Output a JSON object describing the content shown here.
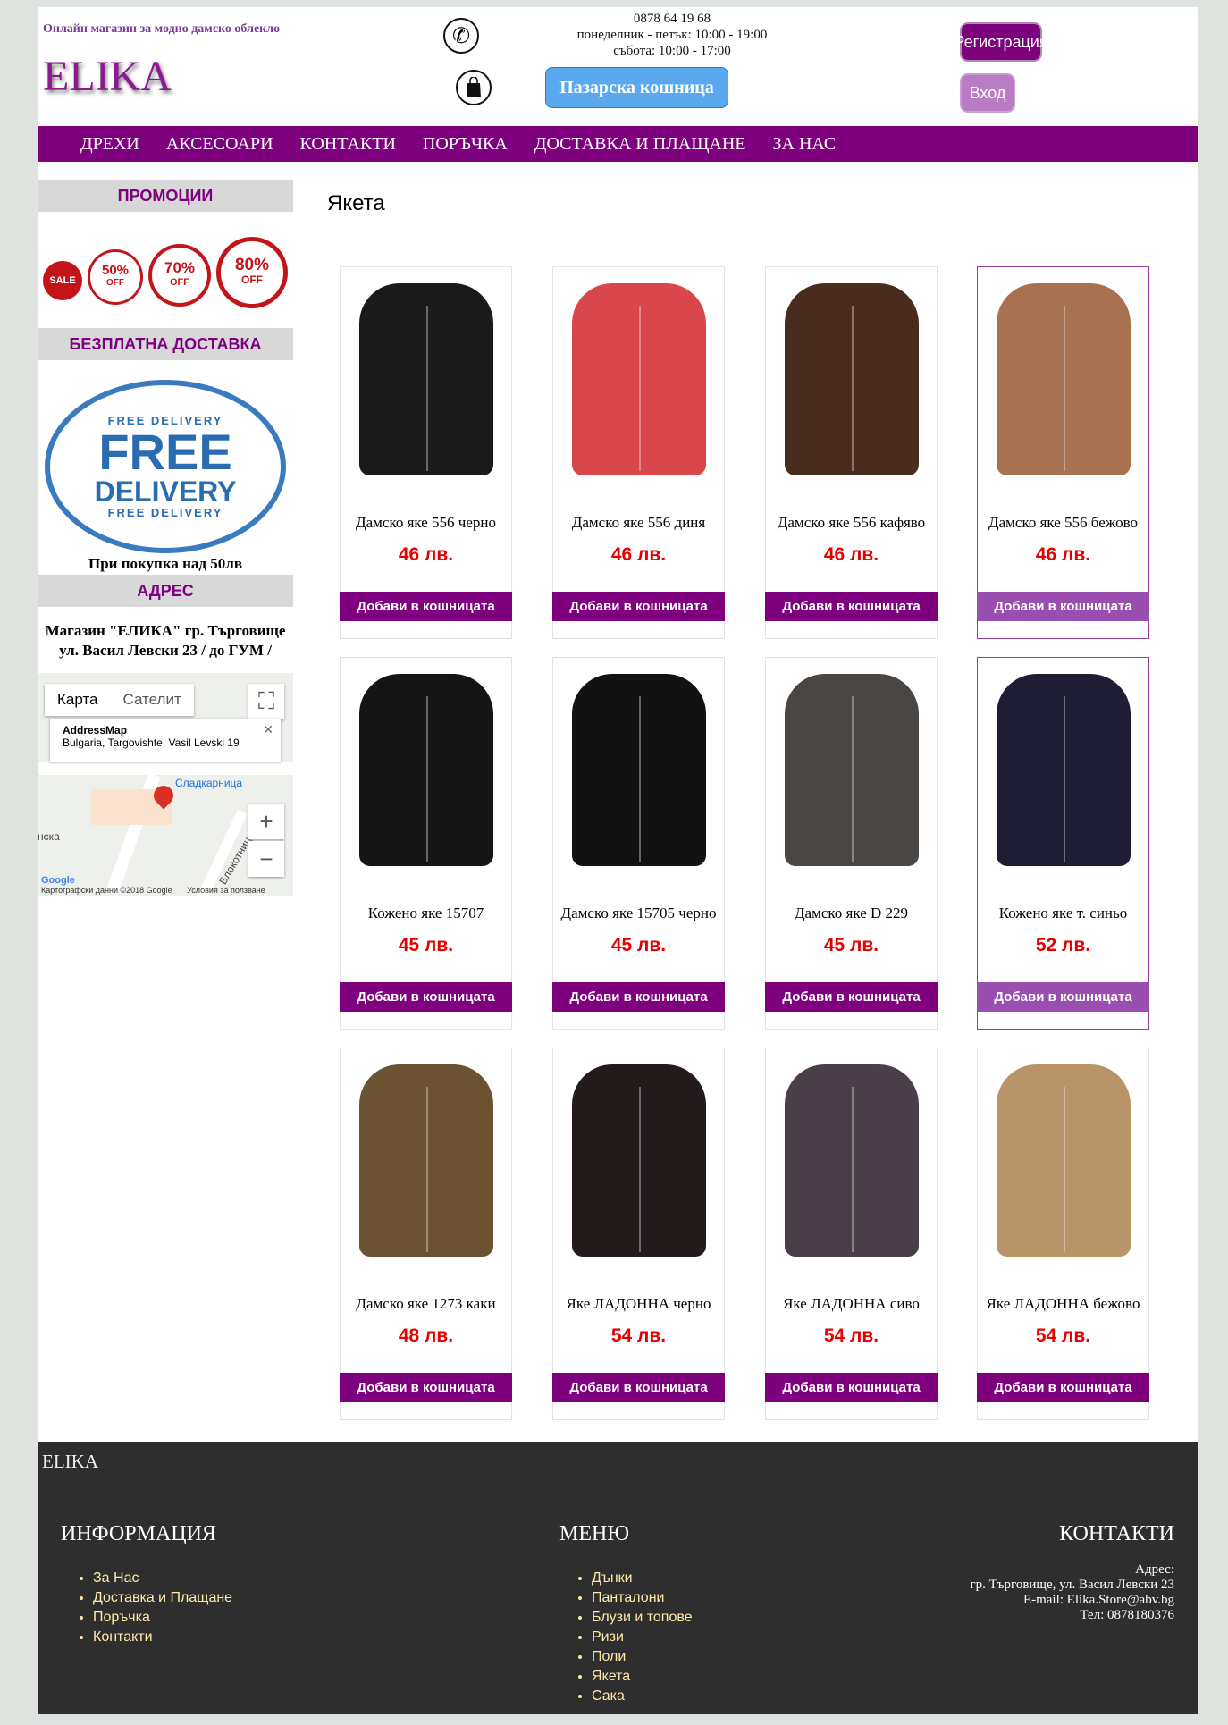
{
  "header": {
    "tagline": "Онлайн магазин за модно дамско облекло",
    "logo": "ELIKA",
    "phone": "0878 64 19 68",
    "hours_weekdays": "понеделник - петък: 10:00 - 19:00",
    "hours_saturday": "събота: 10:00 - 17:00",
    "cart_label": "Пазарска кошница",
    "register_label": "Регистрация",
    "login_label": "Вход"
  },
  "nav": [
    "ДРЕХИ",
    "АКСЕСОАРИ",
    "КОНТАКТИ",
    "ПОРЪЧКА",
    "ДОСТАВКА И ПЛАЩАНЕ",
    "ЗА НАС"
  ],
  "sidebar": {
    "promo_title": "ПРОМОЦИИ",
    "badges": [
      "SALE",
      "50%",
      "70%",
      "80%"
    ],
    "badge_off": "OFF",
    "delivery_title": "БЕЗПЛАТНА ДОСТАВКА",
    "delivery_stamp_ring": "FREE DELIVERY",
    "delivery_stamp_line1": "FREE",
    "delivery_stamp_line2": "DELIVERY",
    "delivery_caption": "При покупка над 50лв",
    "address_title": "АДРЕС",
    "address_line1": "Магазин \"ЕЛИКА\" гр. Търговище",
    "address_line2": "ул. Васил Левски 23 / до ГУМ /",
    "map": {
      "tab_map": "Карта",
      "tab_satellite": "Сателит",
      "card_title": "AddressMap",
      "card_address": "Bulgaria, Targovishte, Vasil Levski 19",
      "place_label": "Сладкарница",
      "street_label": "Блокотница",
      "left_label": "нска",
      "footer_data": "Картографски данни ©2018 Google",
      "footer_terms": "Условия за ползване",
      "google": "Google"
    }
  },
  "content": {
    "title": "Якета",
    "add_label": "Добави в кошницата",
    "products": [
      {
        "name": "Дамско яке 556 черно",
        "price": "46 лв.",
        "color": "#1a1a1a"
      },
      {
        "name": "Дамско яке 556 диня",
        "price": "46 лв.",
        "color": "#d9474a"
      },
      {
        "name": "Дамско яке 556 кафяво",
        "price": "46 лв.",
        "color": "#4a2c1e"
      },
      {
        "name": "Дамско яке 556 бежово",
        "price": "46 лв.",
        "color": "#a8714f"
      },
      {
        "name": "Кожено яке 15707",
        "price": "45 лв.",
        "color": "#151515"
      },
      {
        "name": "Дамско яке 15705 черно",
        "price": "45 лв.",
        "color": "#121212"
      },
      {
        "name": "Дамско яке D 229",
        "price": "45 лв.",
        "color": "#4a4644"
      },
      {
        "name": "Кожено яке т. синьо",
        "price": "52 лв.",
        "color": "#1e1d33"
      },
      {
        "name": "Дамско яке 1273 каки",
        "price": "48 лв.",
        "color": "#6b5232"
      },
      {
        "name": "Яке ЛАДОННА черно",
        "price": "54 лв.",
        "color": "#231a1c"
      },
      {
        "name": "Яке ЛАДОННА сиво",
        "price": "54 лв.",
        "color": "#4a3e48"
      },
      {
        "name": "Яке ЛАДОННА бежово",
        "price": "54 лв.",
        "color": "#b89468"
      }
    ]
  },
  "footer": {
    "brand": "ELIKA",
    "info_title": "ИНФОРМАЦИЯ",
    "info_links": [
      "За Нас",
      "Доставка и Плащане",
      "Поръчка",
      "Контакти"
    ],
    "menu_title": "МЕНЮ",
    "menu_links": [
      "Дънки",
      "Панталони",
      "Блузи и топове",
      "Ризи",
      "Поли",
      "Якета",
      "Сака"
    ],
    "contacts_title": "КОНТАКТИ",
    "address_label": "Адрес:",
    "address": "гр. Търговище, ул. Васил Левски 23",
    "email": "E-mail: Elika.Store@abv.bg",
    "phone": "Тел: 0878180376"
  }
}
